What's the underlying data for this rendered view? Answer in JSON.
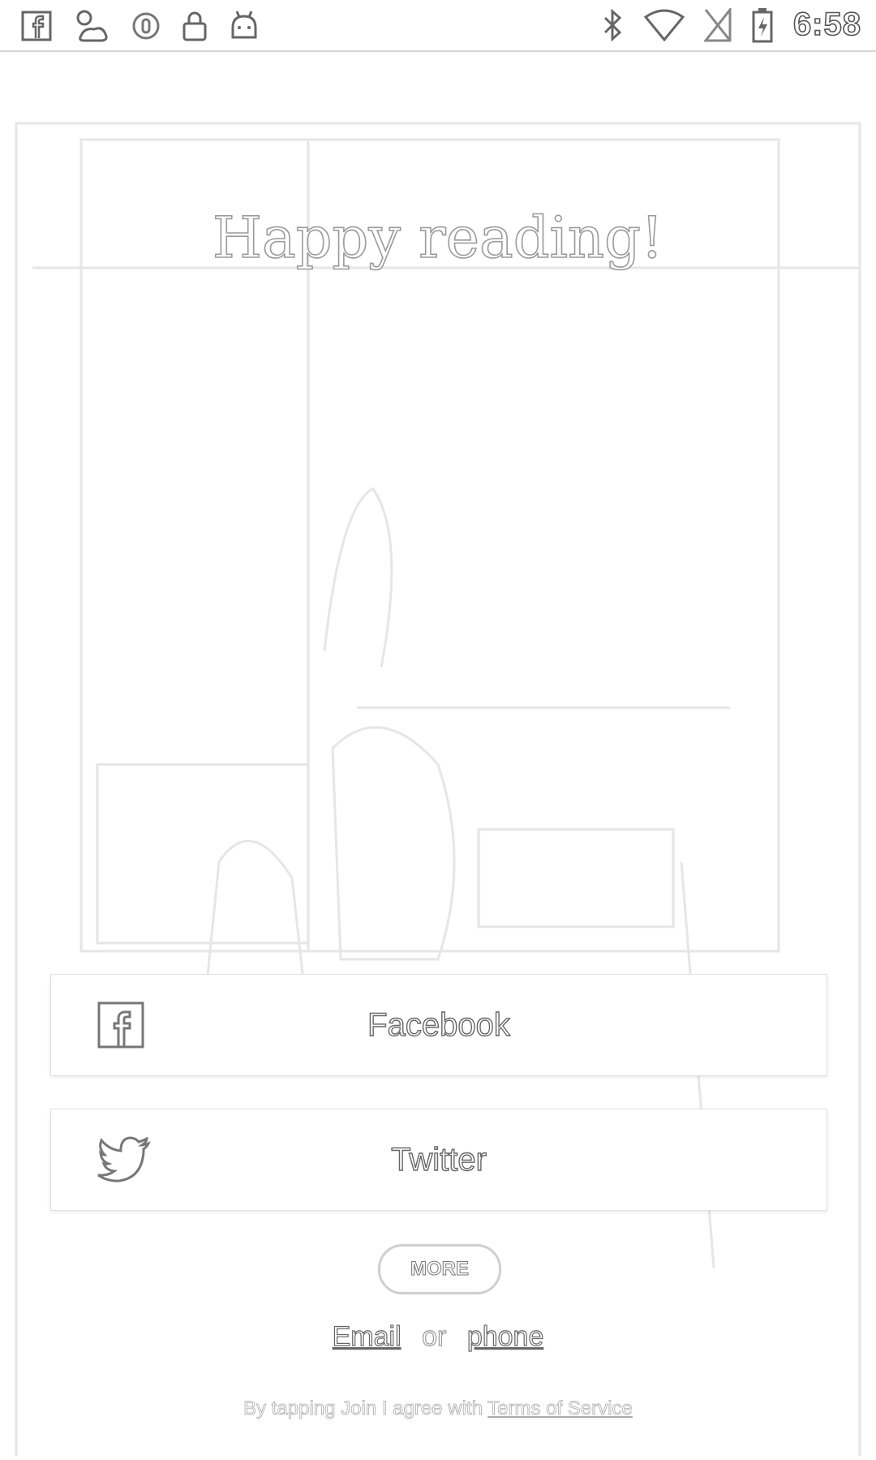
{
  "status_bar": {
    "left_icons": [
      "facebook-icon",
      "weather-icon",
      "circle-o-icon",
      "lock-icon",
      "android-icon"
    ],
    "right_icons": [
      "bluetooth-icon",
      "wifi-icon",
      "no-sim-icon",
      "battery-charging-icon"
    ],
    "time": "6:58"
  },
  "hero": {
    "title": "Happy reading!"
  },
  "login": {
    "facebook_label": "Facebook",
    "twitter_label": "Twitter",
    "more_label": "MORE",
    "email_label": "Email",
    "or_text": "or",
    "phone_label": "phone"
  },
  "footer": {
    "prefix": "By tapping Join I agree with",
    "terms_label": "Terms of Service"
  }
}
